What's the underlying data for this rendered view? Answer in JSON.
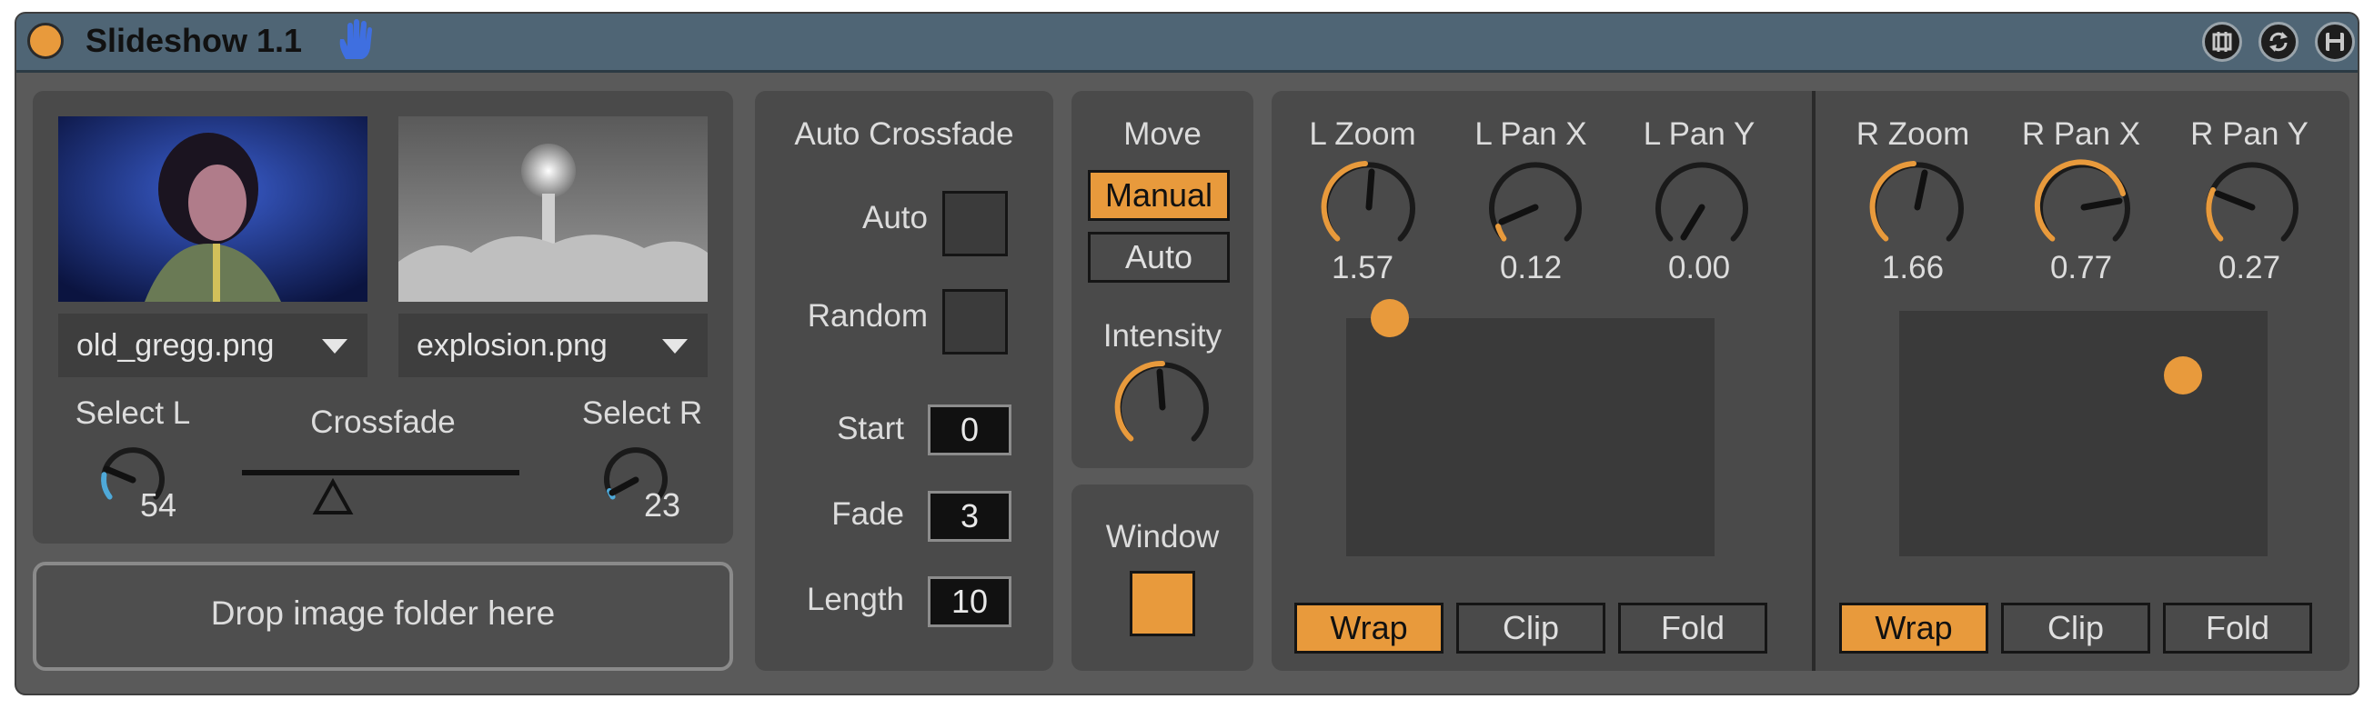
{
  "window": {
    "title": "Slideshow 1.1",
    "accent_color": "#e89a3c",
    "titlebar_color": "#4f6575",
    "icons": [
      "hand-icon",
      "freeze-icon",
      "refresh-icon",
      "save-icon"
    ]
  },
  "images": {
    "left": {
      "file": "old_gregg.png"
    },
    "right": {
      "file": "explosion.png"
    }
  },
  "select": {
    "left_label": "Select L",
    "left_value": "54",
    "crossfade_label": "Crossfade",
    "right_label": "Select R",
    "right_value": "23"
  },
  "drop": {
    "label": "Drop image folder here"
  },
  "auto_crossfade": {
    "title": "Auto Crossfade",
    "auto_label": "Auto",
    "random_label": "Random",
    "start_label": "Start",
    "start_value": "0",
    "fade_label": "Fade",
    "fade_value": "3",
    "length_label": "Length",
    "length_value": "10"
  },
  "move": {
    "title": "Move",
    "options": [
      "Manual",
      "Auto"
    ],
    "selected": "Manual",
    "intensity_label": "Intensity"
  },
  "window_toggle": {
    "label": "Window",
    "on": true
  },
  "left_transform": {
    "zoom_label": "L Zoom",
    "zoom_value": "1.57",
    "panx_label": "L Pan X",
    "panx_value": "0.12",
    "pany_label": "L Pan Y",
    "pany_value": "0.00",
    "modes": [
      "Wrap",
      "Clip",
      "Fold"
    ],
    "selected_mode": "Wrap"
  },
  "right_transform": {
    "zoom_label": "R Zoom",
    "zoom_value": "1.66",
    "panx_label": "R Pan X",
    "panx_value": "0.77",
    "pany_label": "R Pan Y",
    "pany_value": "0.27",
    "modes": [
      "Wrap",
      "Clip",
      "Fold"
    ],
    "selected_mode": "Wrap"
  }
}
